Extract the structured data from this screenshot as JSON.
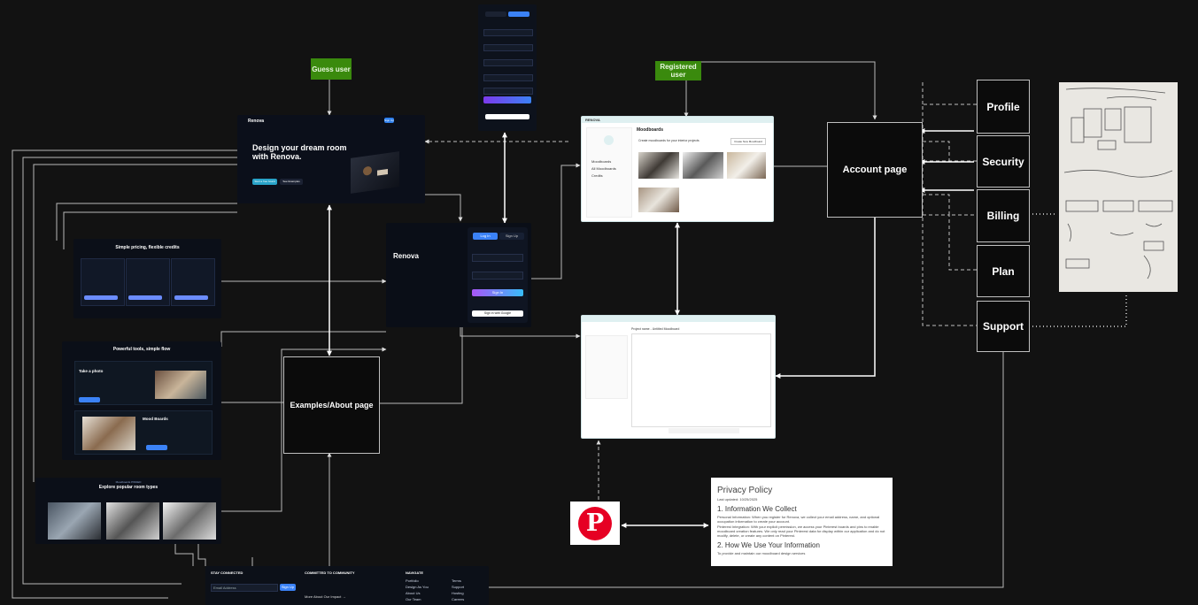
{
  "diagram": {
    "labels": {
      "guest": "Guess user",
      "registered": "Registered user",
      "account": "Account page",
      "examples": "Examples/About page",
      "profile": "Profile",
      "security": "Security",
      "billing": "Billing",
      "plan": "Plan",
      "support": "Support"
    },
    "colors": {
      "tag": "#3a8a0d",
      "line": "#bfbfbf",
      "background": "#121212"
    }
  },
  "landing": {
    "brand": "Renova",
    "nav": [
      "Home",
      "About",
      "Pricing",
      "Contact",
      "Email"
    ],
    "login": "Log in",
    "signup": "Sign Up",
    "headline": "Design your dream room with Renova.",
    "primary_cta": "Start a free board",
    "secondary_cta": "See Examples"
  },
  "pricing": {
    "title": "Simple pricing, flexible credits",
    "plans": [
      {
        "name": "Starter",
        "price": "$0"
      },
      {
        "name": "Pro",
        "price": "$10"
      },
      {
        "name": "Studio",
        "price": "$30"
      }
    ]
  },
  "tools": {
    "title": "Powerful tools, simple flow",
    "step1": "Take a photo",
    "step2": "Mood Boards"
  },
  "rooms": {
    "kicker": "Moodboards PINNED",
    "title": "Explore popular room types"
  },
  "footer": {
    "cols": [
      "STAY CONNECTED",
      "COMMITTED TO COMMUNITY",
      "NAVIGATE"
    ],
    "email_placeholder": "Email Address",
    "signup": "Sign Up",
    "impact_link": "More About Our Impact →",
    "nav_links": [
      "Portfolio",
      "Design As You",
      "About Us",
      "Our Team",
      "Blog"
    ],
    "nav_links2": [
      "Terms",
      "Support",
      "Hosting",
      "Careers",
      "Privacy Policy"
    ]
  },
  "login_panel": {
    "brand": "Renova",
    "tab_login": "Log In",
    "tab_signup": "Sign Up",
    "email_label": "Email",
    "password_label": "Password",
    "button": "Sign In",
    "google": "Sign in with Google"
  },
  "moodboards": {
    "brand": "RENOVA",
    "title": "Moodboards",
    "create_title": "Create moodboards for your interior projects",
    "create_btn": "Create New Moodboard",
    "user": "User",
    "sidebar": [
      "Moodboards",
      "All Moodboards",
      "Credits"
    ],
    "projects": [
      "Bedroom Project",
      "Kitchen Project",
      "Office Project",
      "Living Room Project"
    ]
  },
  "editor": {
    "title": "Project name - Untitled Moodboard"
  },
  "privacy": {
    "title": "Privacy Policy",
    "updated": "Last updated: 10/25/2025",
    "section1": "1. Information We Collect",
    "p1": "Personal Information: When you register for Renova, we collect your email address, name, and optional occupation information to create your account.",
    "p2": "Pinterest Integration: With your explicit permission, we access your Pinterest boards and pins to enable moodboard creation features. We only read your Pinterest data for display within our application and do not modify, delete, or create any content on Pinterest.",
    "section2": "2. How We Use Your Information",
    "bullet1": "To provide and maintain our moodboard design services"
  },
  "pinterest": {
    "glyph": "P",
    "color": "#e60023"
  }
}
